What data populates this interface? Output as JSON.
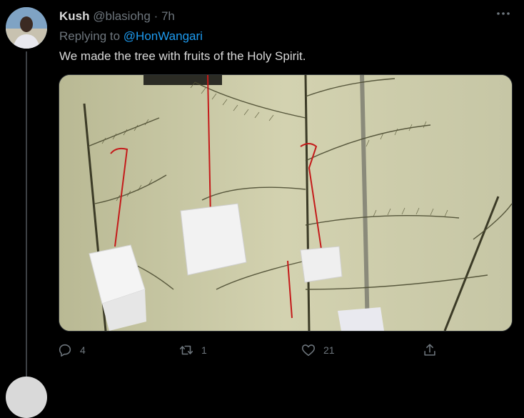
{
  "tweet": {
    "author_name": "Kush",
    "author_handle": "@blasiohg",
    "separator": "·",
    "time": "7h",
    "replying_to_prefix": "Replying to",
    "replying_to_handle": "@HonWangari",
    "text": "We made the tree with fruits of the Holy Spirit."
  },
  "actions": {
    "reply_count": "4",
    "retweet_count": "1",
    "like_count": "21"
  },
  "icons": {
    "more": "more-horizontal-icon",
    "reply": "reply-icon",
    "retweet": "retweet-icon",
    "like": "heart-icon",
    "share": "share-icon"
  },
  "colors": {
    "background": "#000000",
    "text": "#d9d9d9",
    "muted": "#6e767d",
    "link": "#1d9bf0",
    "thread_line": "#3d4145"
  }
}
